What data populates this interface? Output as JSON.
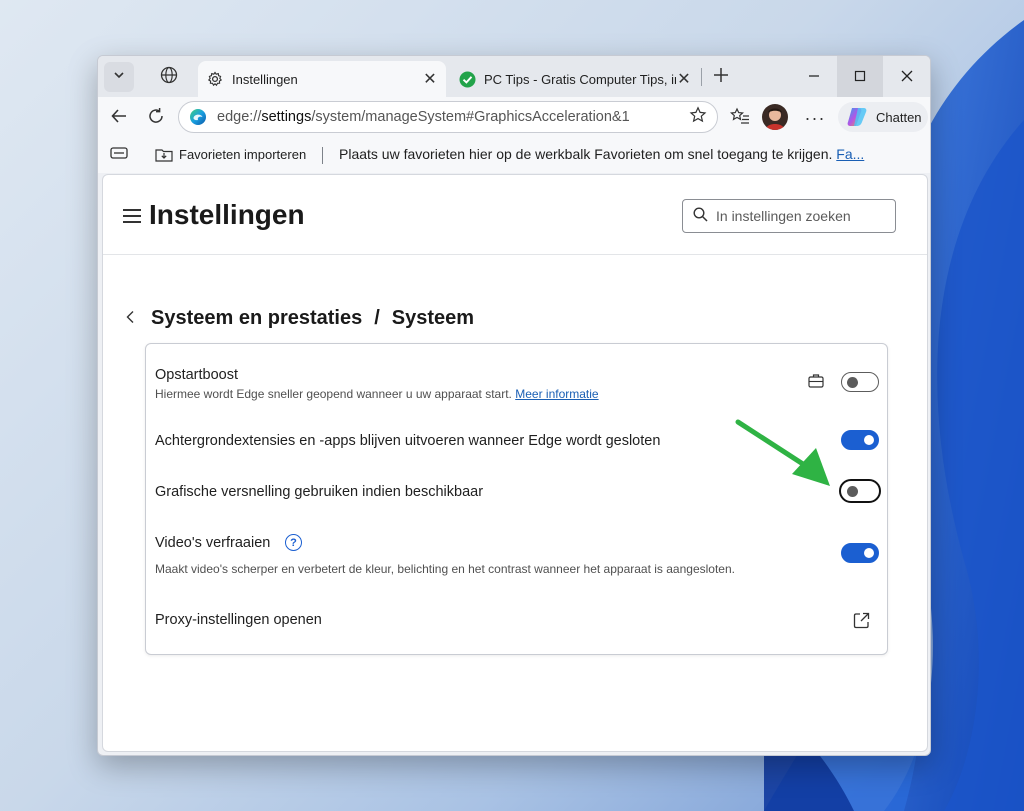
{
  "browser": {
    "tabs": [
      {
        "title": "Instellingen",
        "active": true
      },
      {
        "title": "PC Tips - Gratis Computer Tips, inf",
        "active": false
      }
    ],
    "address": {
      "scheme": "edge://",
      "host": "settings",
      "path": "/system/manageSystem#GraphicsAcceleration&1"
    },
    "copilot_label": "Chatten",
    "favorites_bar": {
      "import_label": "Favorieten importeren",
      "hint_text": "Plaats uw favorieten hier op de werkbalk Favorieten om snel toegang te krijgen.",
      "hint_link": "Fa..."
    }
  },
  "settings": {
    "title": "Instellingen",
    "search_placeholder": "In instellingen zoeken",
    "breadcrumb": {
      "parent": "Systeem en prestaties",
      "separator": "/",
      "current": "Systeem"
    },
    "rows": [
      {
        "title": "Opstartboost",
        "description": "Hiermee wordt Edge sneller geopend wanneer u uw apparaat start.",
        "link": "Meer informatie",
        "enabled": false
      },
      {
        "title": "Achtergrondextensies en -apps blijven uitvoeren wanneer Edge wordt gesloten",
        "enabled": true
      },
      {
        "title": "Grafische versnelling gebruiken indien beschikbaar",
        "enabled": false,
        "focused": true
      },
      {
        "title": "Video's verfraaien",
        "description": "Maakt video's scherper en verbetert de kleur, belichting en het contrast wanneer het apparaat is aangesloten.",
        "help_glyph": "?",
        "enabled": true
      },
      {
        "title": "Proxy-instellingen openen"
      }
    ]
  },
  "colors": {
    "accent": "#1b5fd1",
    "annotation_arrow": "#2fb344"
  }
}
